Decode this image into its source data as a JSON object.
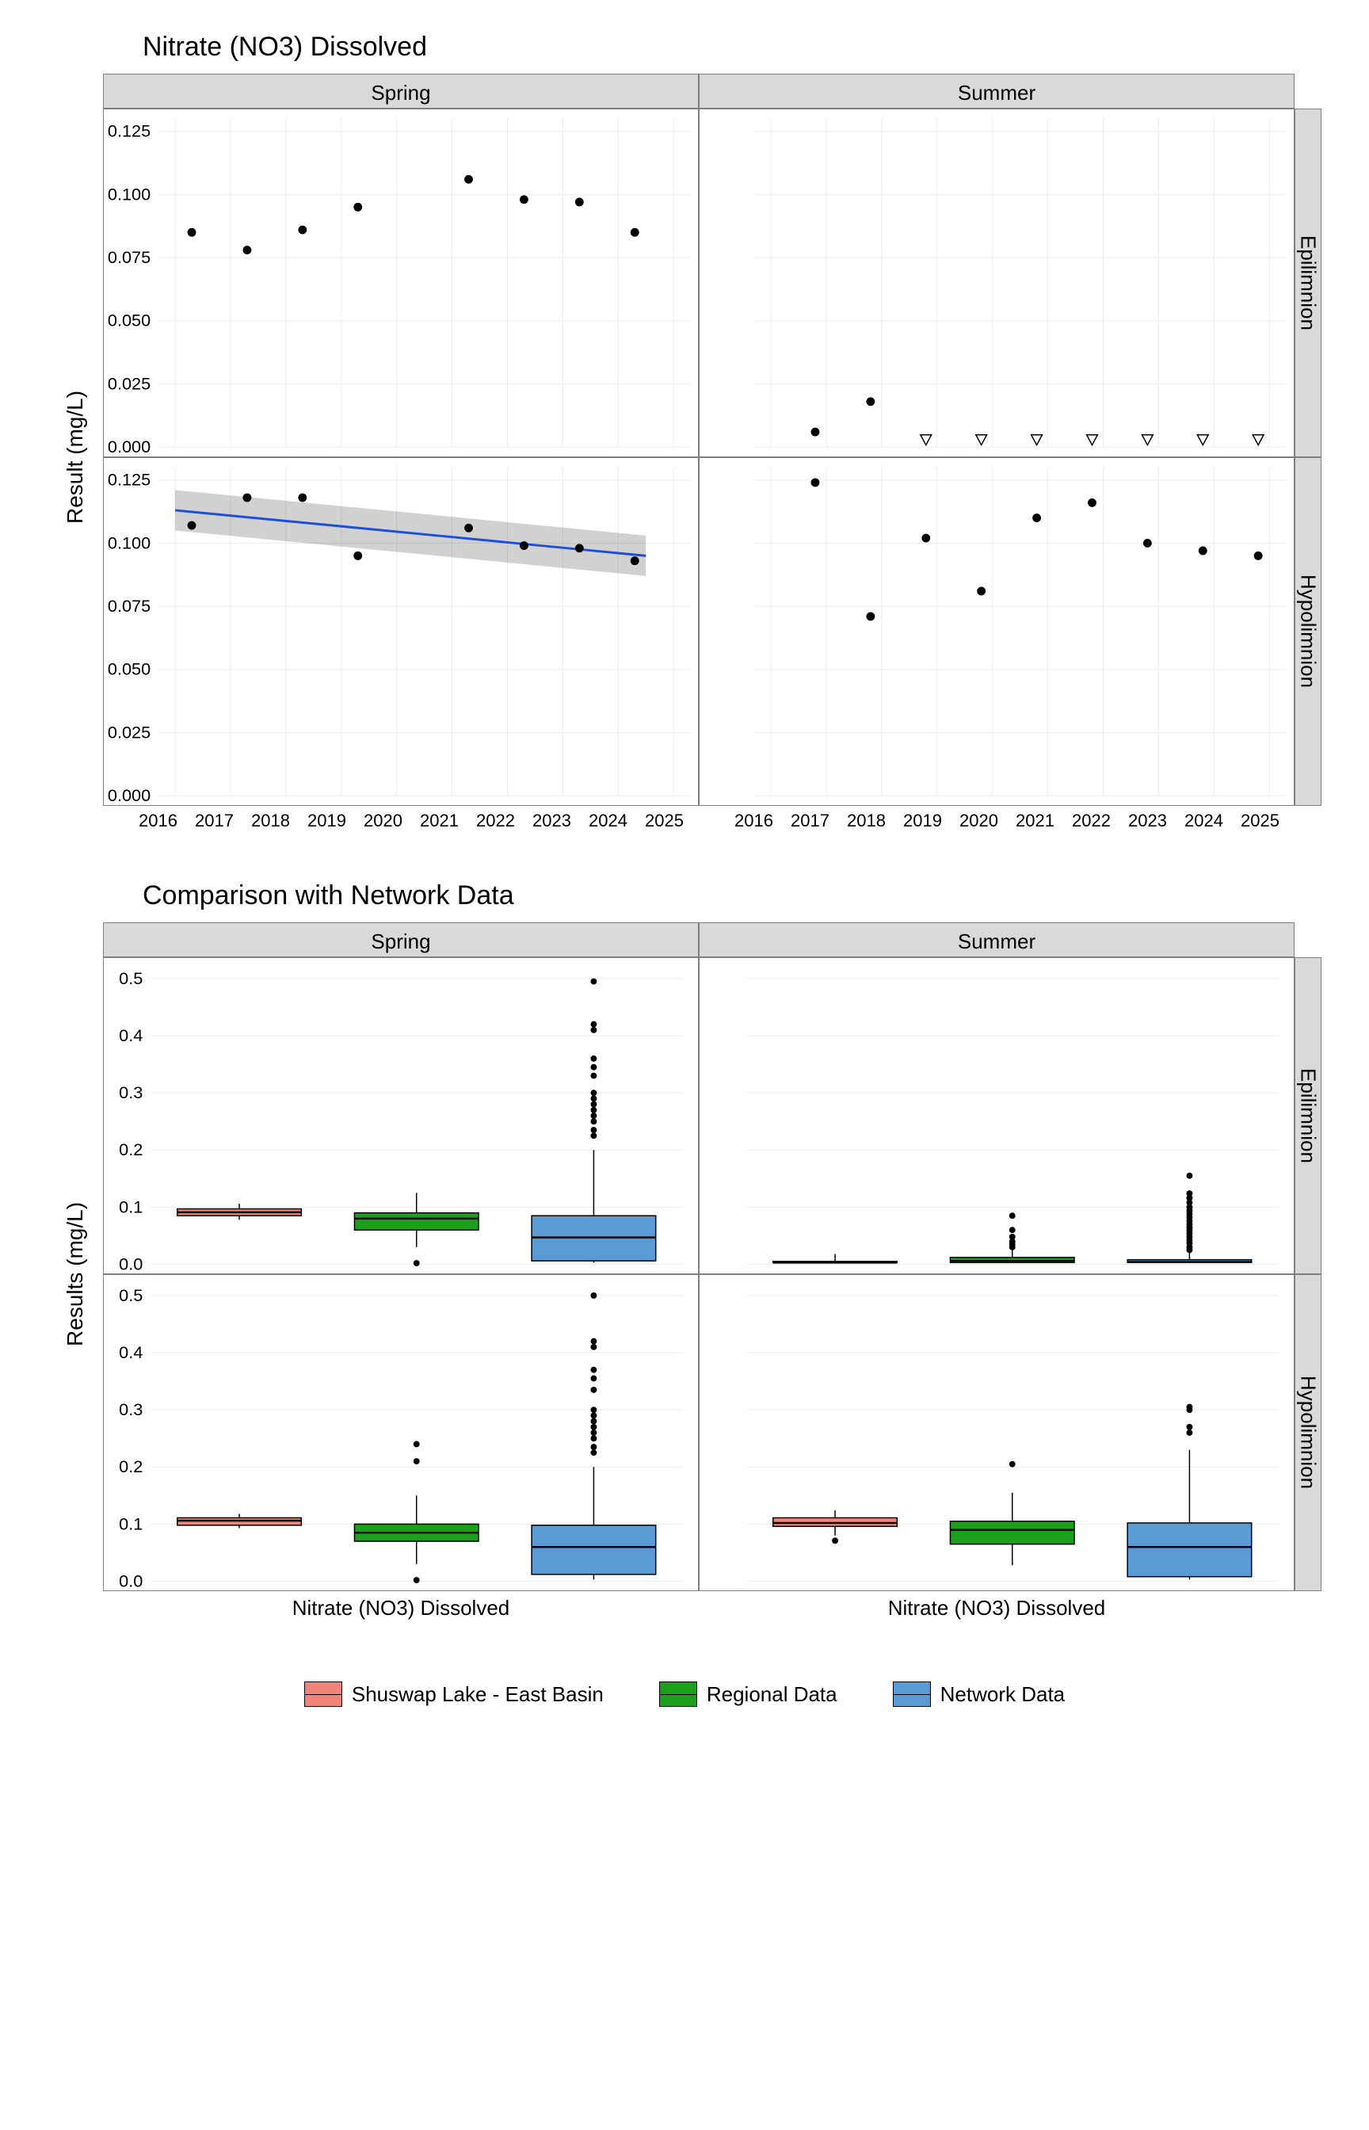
{
  "top": {
    "title": "Nitrate (NO3) Dissolved",
    "ylabel": "Result (mg/L)",
    "cols": [
      "Spring",
      "Summer"
    ],
    "rows": [
      "Epilimnion",
      "Hypolimnion"
    ],
    "x_ticks": [
      2016,
      2017,
      2018,
      2019,
      2020,
      2021,
      2022,
      2023,
      2024,
      2025
    ],
    "ylim": [
      0,
      0.13
    ],
    "y_ticks": [
      0.0,
      0.025,
      0.05,
      0.075,
      0.1,
      0.125
    ]
  },
  "bottom": {
    "title": "Comparison with Network Data",
    "ylabel": "Results (mg/L)",
    "xlabel": "Nitrate (NO3) Dissolved",
    "cols": [
      "Spring",
      "Summer"
    ],
    "rows": [
      "Epilimnion",
      "Hypolimnion"
    ],
    "ylim": [
      0,
      0.52
    ],
    "y_ticks": [
      0.0,
      0.1,
      0.2,
      0.3,
      0.4,
      0.5
    ]
  },
  "legend": [
    "Shuswap Lake - East Basin",
    "Regional Data",
    "Network Data"
  ],
  "chart_data": [
    {
      "type": "scatter",
      "panel": "top",
      "row": "Epilimnion",
      "col": "Spring",
      "series": [
        {
          "name": "obs",
          "points": [
            {
              "x": 2016.3,
              "y": 0.085
            },
            {
              "x": 2017.3,
              "y": 0.078
            },
            {
              "x": 2018.3,
              "y": 0.086
            },
            {
              "x": 2019.3,
              "y": 0.095
            },
            {
              "x": 2021.3,
              "y": 0.106
            },
            {
              "x": 2022.3,
              "y": 0.098
            },
            {
              "x": 2023.3,
              "y": 0.097
            },
            {
              "x": 2024.3,
              "y": 0.085
            }
          ]
        }
      ]
    },
    {
      "type": "scatter",
      "panel": "top",
      "row": "Epilimnion",
      "col": "Summer",
      "series": [
        {
          "name": "obs",
          "points": [
            {
              "x": 2016.8,
              "y": 0.006
            },
            {
              "x": 2017.8,
              "y": 0.018
            }
          ]
        },
        {
          "name": "below-dl",
          "marker": "open-triangle",
          "points": [
            {
              "x": 2018.8,
              "y": 0.003
            },
            {
              "x": 2019.8,
              "y": 0.003
            },
            {
              "x": 2020.8,
              "y": 0.003
            },
            {
              "x": 2021.8,
              "y": 0.003
            },
            {
              "x": 2022.8,
              "y": 0.003
            },
            {
              "x": 2023.8,
              "y": 0.003
            },
            {
              "x": 2024.8,
              "y": 0.003
            }
          ]
        }
      ]
    },
    {
      "type": "scatter",
      "panel": "top",
      "row": "Hypolimnion",
      "col": "Spring",
      "series": [
        {
          "name": "obs",
          "points": [
            {
              "x": 2016.3,
              "y": 0.107
            },
            {
              "x": 2017.3,
              "y": 0.118
            },
            {
              "x": 2018.3,
              "y": 0.118
            },
            {
              "x": 2019.3,
              "y": 0.095
            },
            {
              "x": 2021.3,
              "y": 0.106
            },
            {
              "x": 2022.3,
              "y": 0.099
            },
            {
              "x": 2023.3,
              "y": 0.098
            },
            {
              "x": 2024.3,
              "y": 0.093
            }
          ]
        }
      ],
      "trend": {
        "type": "lm",
        "x": [
          2016,
          2024.5
        ],
        "y": [
          0.113,
          0.095
        ],
        "ci_lower": [
          0.105,
          0.087
        ],
        "ci_upper": [
          0.121,
          0.103
        ]
      }
    },
    {
      "type": "scatter",
      "panel": "top",
      "row": "Hypolimnion",
      "col": "Summer",
      "series": [
        {
          "name": "obs",
          "points": [
            {
              "x": 2016.8,
              "y": 0.124
            },
            {
              "x": 2017.8,
              "y": 0.071
            },
            {
              "x": 2018.8,
              "y": 0.102
            },
            {
              "x": 2019.8,
              "y": 0.081
            },
            {
              "x": 2020.8,
              "y": 0.11
            },
            {
              "x": 2021.8,
              "y": 0.116
            },
            {
              "x": 2022.8,
              "y": 0.1
            },
            {
              "x": 2023.8,
              "y": 0.097
            },
            {
              "x": 2024.8,
              "y": 0.095
            }
          ]
        }
      ]
    },
    {
      "type": "boxplot",
      "panel": "bottom",
      "row": "Epilimnion",
      "col": "Spring",
      "groups": [
        {
          "name": "Shuswap Lake - East Basin",
          "min": 0.078,
          "q1": 0.085,
          "median": 0.091,
          "q3": 0.097,
          "max": 0.106,
          "outliers": []
        },
        {
          "name": "Regional Data",
          "min": 0.03,
          "q1": 0.06,
          "median": 0.08,
          "q3": 0.09,
          "max": 0.125,
          "outliers": [
            0.002
          ]
        },
        {
          "name": "Network Data",
          "min": 0.003,
          "q1": 0.006,
          "median": 0.047,
          "q3": 0.085,
          "max": 0.2,
          "outliers": [
            0.225,
            0.235,
            0.25,
            0.26,
            0.27,
            0.28,
            0.29,
            0.3,
            0.33,
            0.345,
            0.36,
            0.41,
            0.42,
            0.495
          ]
        }
      ]
    },
    {
      "type": "boxplot",
      "panel": "bottom",
      "row": "Epilimnion",
      "col": "Summer",
      "groups": [
        {
          "name": "Shuswap Lake - East Basin",
          "min": 0.003,
          "q1": 0.003,
          "median": 0.003,
          "q3": 0.005,
          "max": 0.018,
          "outliers": []
        },
        {
          "name": "Regional Data",
          "min": 0.003,
          "q1": 0.003,
          "median": 0.006,
          "q3": 0.012,
          "max": 0.026,
          "outliers": [
            0.03,
            0.035,
            0.04,
            0.048,
            0.06,
            0.085
          ]
        },
        {
          "name": "Network Data",
          "min": 0.003,
          "q1": 0.003,
          "median": 0.004,
          "q3": 0.008,
          "max": 0.02,
          "outliers": [
            0.025,
            0.03,
            0.037,
            0.042,
            0.048,
            0.054,
            0.059,
            0.064,
            0.07,
            0.076,
            0.082,
            0.088,
            0.094,
            0.1,
            0.108,
            0.116,
            0.124,
            0.155
          ]
        }
      ]
    },
    {
      "type": "boxplot",
      "panel": "bottom",
      "row": "Hypolimnion",
      "col": "Spring",
      "groups": [
        {
          "name": "Shuswap Lake - East Basin",
          "min": 0.093,
          "q1": 0.098,
          "median": 0.106,
          "q3": 0.111,
          "max": 0.118,
          "outliers": []
        },
        {
          "name": "Regional Data",
          "min": 0.03,
          "q1": 0.07,
          "median": 0.085,
          "q3": 0.1,
          "max": 0.15,
          "outliers": [
            0.002,
            0.21,
            0.24
          ]
        },
        {
          "name": "Network Data",
          "min": 0.003,
          "q1": 0.012,
          "median": 0.06,
          "q3": 0.098,
          "max": 0.2,
          "outliers": [
            0.225,
            0.235,
            0.25,
            0.26,
            0.27,
            0.28,
            0.29,
            0.3,
            0.335,
            0.355,
            0.37,
            0.41,
            0.42,
            0.5
          ]
        }
      ]
    },
    {
      "type": "boxplot",
      "panel": "bottom",
      "row": "Hypolimnion",
      "col": "Summer",
      "groups": [
        {
          "name": "Shuswap Lake - East Basin",
          "min": 0.08,
          "q1": 0.096,
          "median": 0.102,
          "q3": 0.111,
          "max": 0.124,
          "outliers": [
            0.071
          ]
        },
        {
          "name": "Regional Data",
          "min": 0.028,
          "q1": 0.065,
          "median": 0.09,
          "q3": 0.105,
          "max": 0.155,
          "outliers": [
            0.205
          ]
        },
        {
          "name": "Network Data",
          "min": 0.003,
          "q1": 0.008,
          "median": 0.06,
          "q3": 0.102,
          "max": 0.23,
          "outliers": [
            0.26,
            0.27,
            0.3,
            0.305
          ]
        }
      ]
    }
  ]
}
